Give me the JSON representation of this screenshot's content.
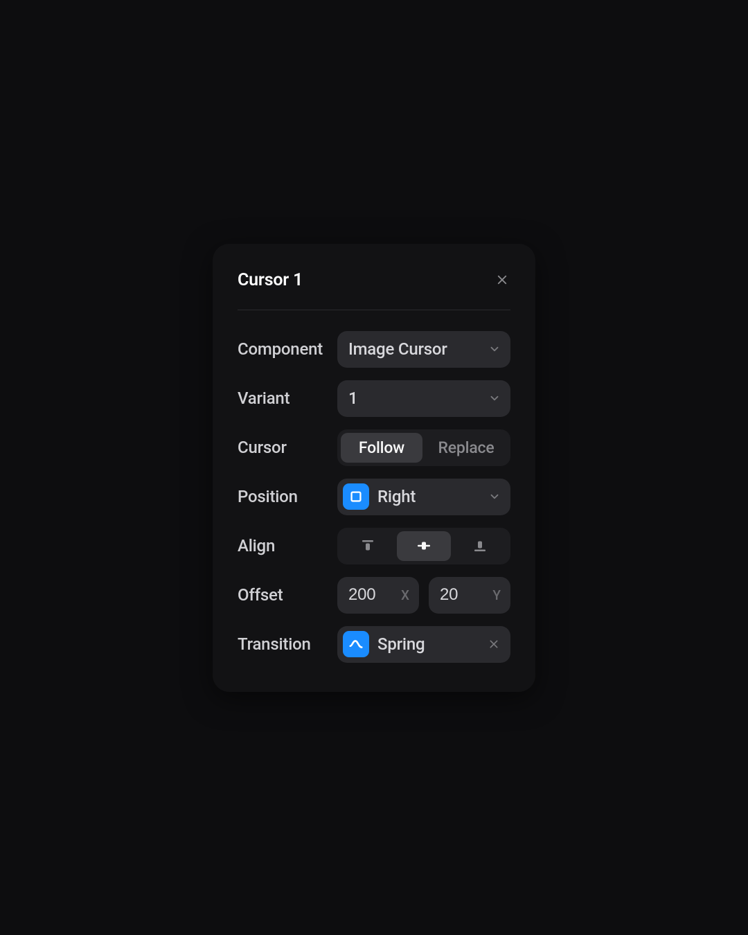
{
  "panel": {
    "title": "Cursor 1",
    "rows": {
      "component": {
        "label": "Component",
        "value": "Image Cursor"
      },
      "variant": {
        "label": "Variant",
        "value": "1"
      },
      "cursor": {
        "label": "Cursor",
        "options": {
          "follow": "Follow",
          "replace": "Replace"
        },
        "selected": "follow"
      },
      "position": {
        "label": "Position",
        "value": "Right"
      },
      "align": {
        "label": "Align",
        "selected": "middle"
      },
      "offset": {
        "label": "Offset",
        "x": {
          "value": "200",
          "suffix": "X"
        },
        "y": {
          "value": "20",
          "suffix": "Y"
        }
      },
      "transition": {
        "label": "Transition",
        "value": "Spring"
      }
    }
  }
}
